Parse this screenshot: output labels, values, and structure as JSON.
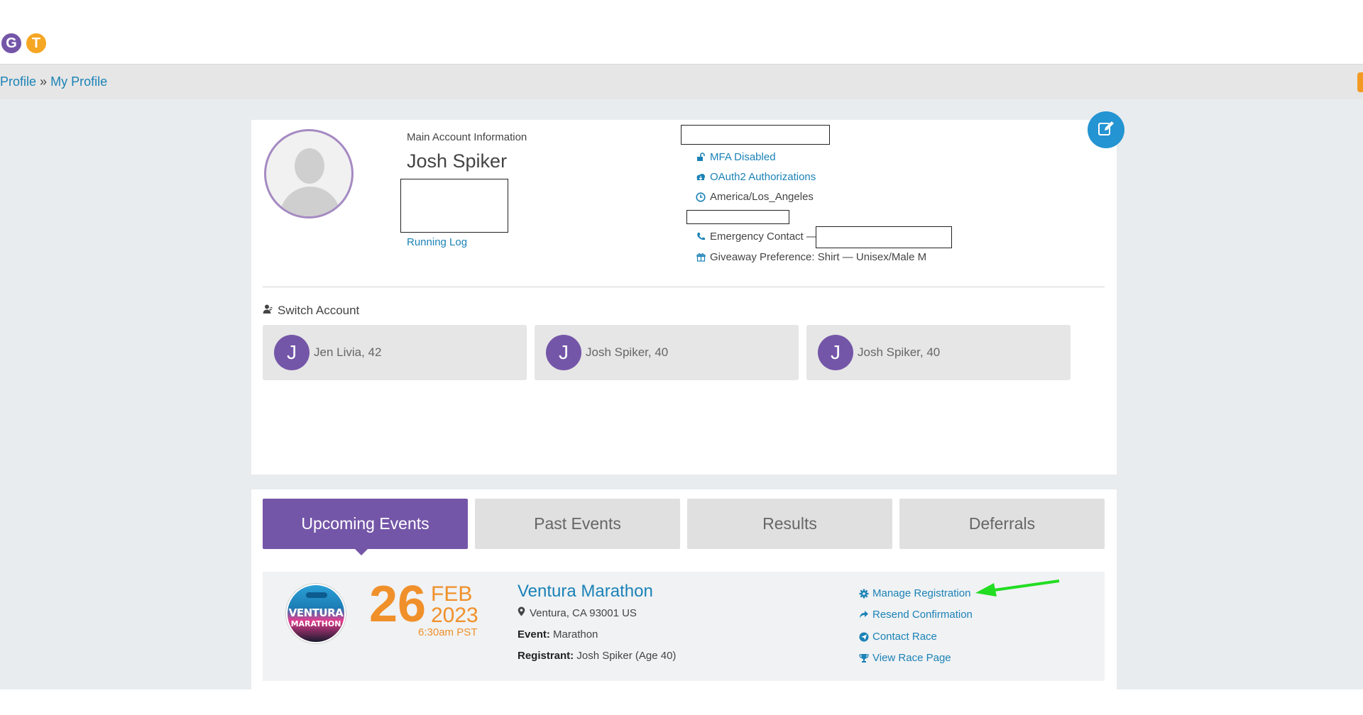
{
  "topbar": {
    "badges": [
      {
        "letter": "G",
        "color": "#7456a8"
      },
      {
        "letter": "T",
        "color": "#f5a623"
      }
    ]
  },
  "breadcrumb": {
    "parent": "Profile",
    "separator": "»",
    "current": "My Profile"
  },
  "profile": {
    "section_label": "Main Account Information",
    "name": "Josh Spiker",
    "running_log": "Running Log",
    "info": {
      "mfa": "MFA Disabled",
      "oauth": "OAuth2 Authorizations",
      "timezone": "America/Los_Angeles",
      "emergency_label": "Emergency Contact —",
      "giveaway": "Giveaway Preference: Shirt — Unisex/Male M"
    },
    "edit_icon": "edit-icon"
  },
  "switch_account": {
    "title": "Switch Account",
    "accounts": [
      {
        "initial": "J",
        "name": "Jen Livia, 42"
      },
      {
        "initial": "J",
        "name": "Josh Spiker, 40"
      },
      {
        "initial": "J",
        "name": "Josh Spiker, 40"
      }
    ]
  },
  "tabs": [
    {
      "label": "Upcoming Events",
      "active": true
    },
    {
      "label": "Past Events",
      "active": false
    },
    {
      "label": "Results",
      "active": false
    },
    {
      "label": "Deferrals",
      "active": false
    }
  ],
  "event": {
    "logo_line1": "VENTURA",
    "logo_line2": "MARATHON",
    "day": "26",
    "month": "FEB",
    "year": "2023",
    "time": "6:30am PST",
    "title": "Ventura Marathon",
    "location": "Ventura, CA 93001 US",
    "event_label": "Event:",
    "event_value": "Marathon",
    "registrant_label": "Registrant:",
    "registrant_value": "Josh Spiker (Age 40)",
    "actions": {
      "manage": "Manage Registration",
      "resend": "Resend Confirmation",
      "contact": "Contact Race",
      "view": "View Race Page"
    }
  },
  "colors": {
    "accent_purple": "#7456a8",
    "link_blue": "#1b82b6",
    "date_orange": "#f0902a",
    "annotation_arrow": "#22dd22"
  }
}
